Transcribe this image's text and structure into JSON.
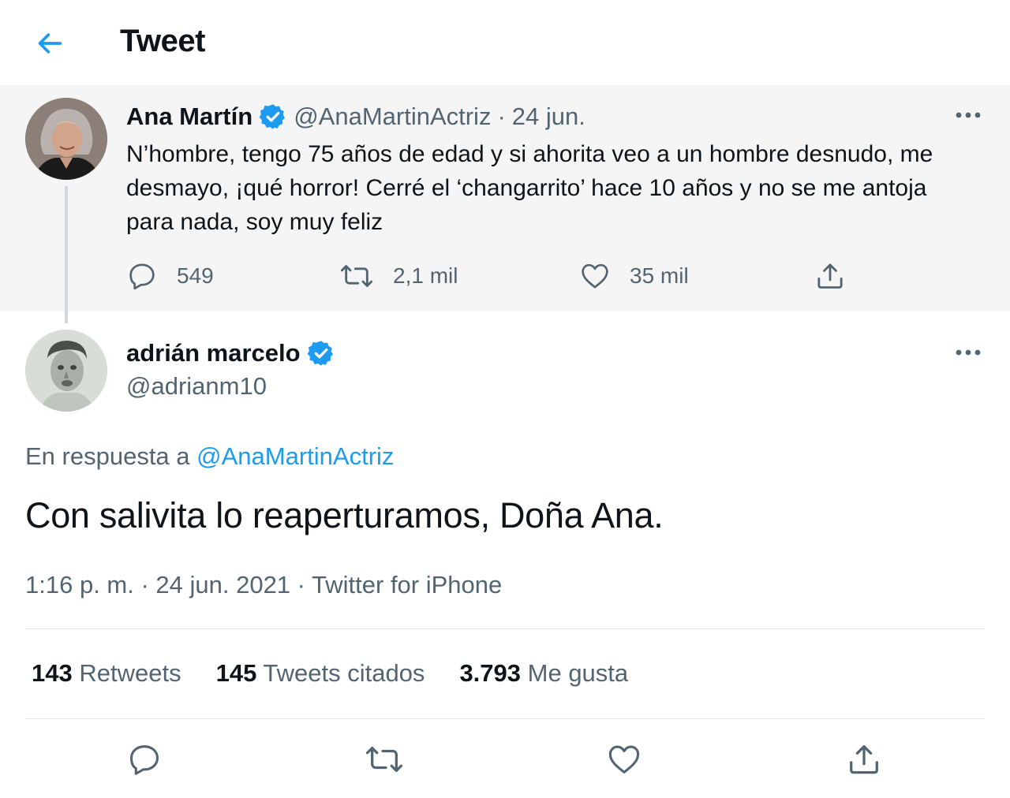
{
  "header": {
    "title": "Tweet"
  },
  "parent_tweet": {
    "name": "Ana Martín",
    "handle": "@AnaMartinActriz",
    "separator": "·",
    "date": "24 jun.",
    "text": "N’hombre, tengo 75 años de edad y si ahorita veo a un hombre desnudo, me desmayo, ¡qué horror! Cerré el ‘changarrito’ hace 10 años y no se me antoja para nada, soy muy feliz",
    "replies": "549",
    "retweets": "2,1 mil",
    "likes": "35 mil"
  },
  "reply_tweet": {
    "name": "adrián marcelo",
    "handle": "@adrianm10",
    "reply_prefix": "En respuesta a",
    "reply_to": "@AnaMartinActriz",
    "text": "Con salivita lo reaperturamos, Doña Ana.",
    "timestamp": "1:16 p. m. · 24 jun. 2021 · Twitter for iPhone"
  },
  "stats": [
    {
      "count": "143",
      "label": "Retweets"
    },
    {
      "count": "145",
      "label": "Tweets citados"
    },
    {
      "count": "3.793",
      "label": "Me gusta"
    }
  ],
  "colors": {
    "accent": "#1d9bf0",
    "muted_text": "#536471",
    "parent_background": "#f5f5f5",
    "icon_gray": "#536471"
  },
  "icons": {
    "back": "arrow-left-icon",
    "verified": "verified-badge-icon",
    "more": "more-icon",
    "reply": "reply-icon",
    "retweet": "retweet-icon",
    "like": "heart-icon",
    "share": "share-icon"
  }
}
